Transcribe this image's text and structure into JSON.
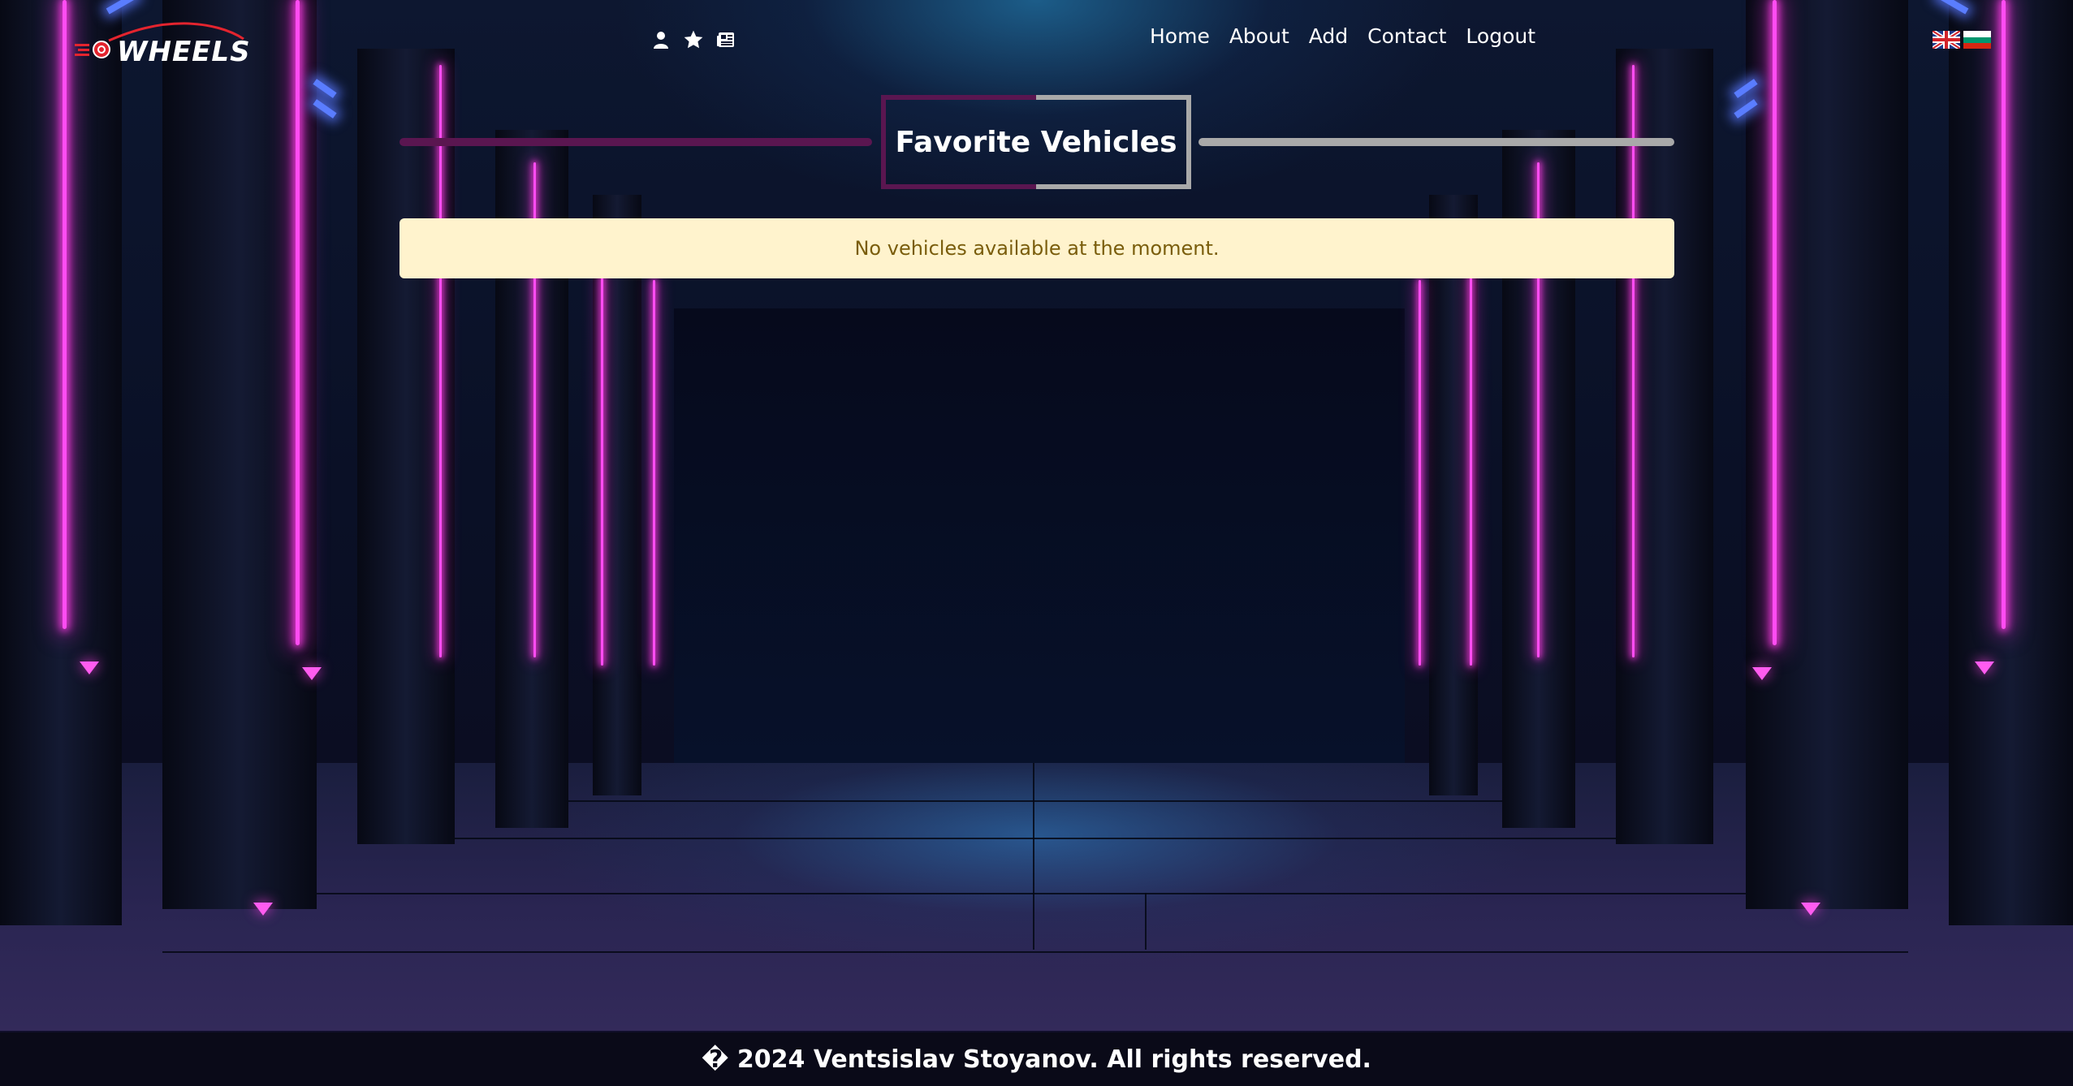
{
  "header": {
    "logo_text": "WHEELS",
    "icons": [
      "user-icon",
      "star-icon",
      "newspaper-icon"
    ],
    "nav": {
      "home": "Home",
      "about": "About",
      "add": "Add",
      "contact": "Contact",
      "logout": "Logout"
    },
    "languages": [
      "flag-uk-icon",
      "flag-bulgaria-icon"
    ]
  },
  "main": {
    "title": "Favorite Vehicles",
    "alert_text": "No vehicles available at the moment."
  },
  "footer": {
    "text": "� 2024 Ventsislav Stoyanov. All rights reserved."
  },
  "colors": {
    "alert_background": "#fff3cd",
    "alert_text": "#7a5d0c",
    "title_accent_left": "#5a1650",
    "title_accent_right": "#a9a9a9",
    "neon": "#ff4cf2"
  }
}
